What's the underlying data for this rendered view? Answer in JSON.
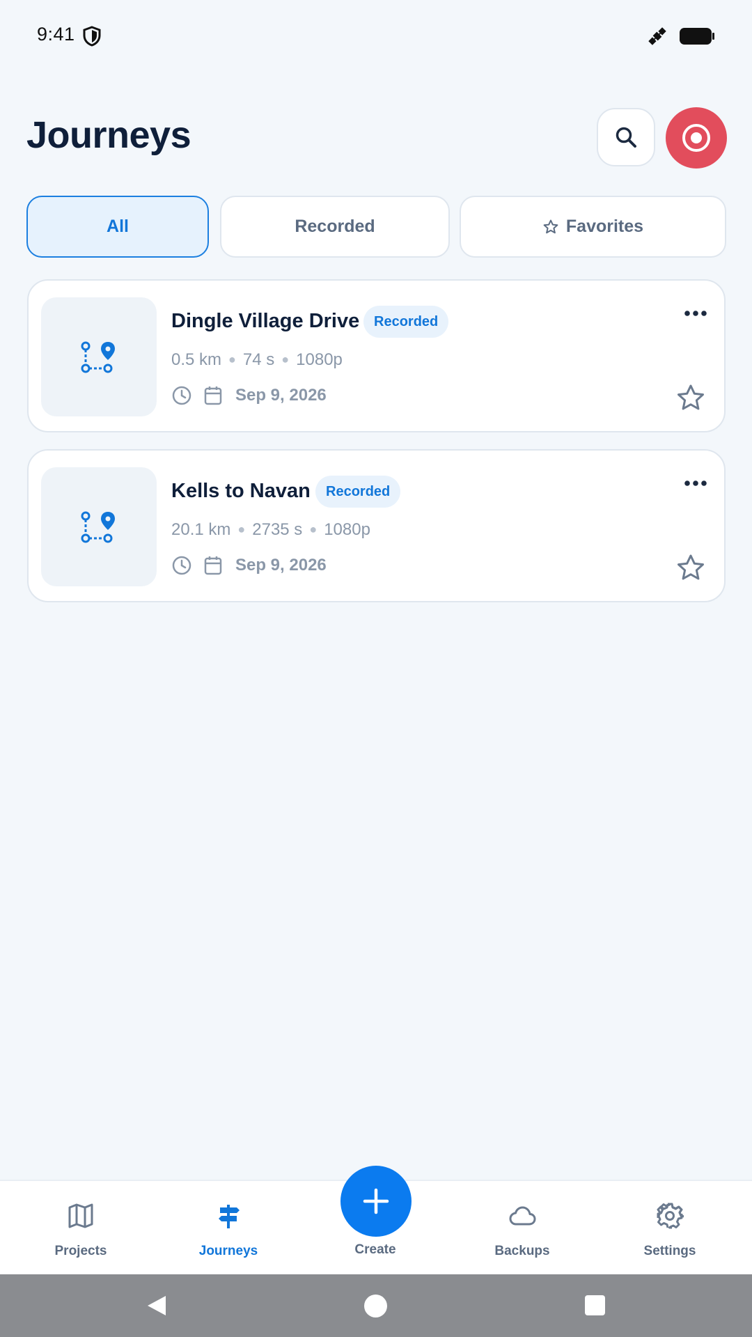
{
  "status_bar": {
    "time": "9:41"
  },
  "header": {
    "title": "Journeys",
    "search_icon": "search-icon",
    "record_icon": "record-icon"
  },
  "filters": {
    "all": "All",
    "recorded": "Recorded",
    "favorites": "Favorites",
    "active": "All"
  },
  "journeys": [
    {
      "title": "Dingle Village Drive",
      "badge": "Recorded",
      "distance": "0.5 km",
      "duration": "74 s",
      "resolution": "1080p",
      "date": "Sep 9, 2026",
      "favorite": false
    },
    {
      "title": "Kells to Navan",
      "badge": "Recorded",
      "distance": "20.1 km",
      "duration": "2735 s",
      "resolution": "1080p",
      "date": "Sep 9, 2026",
      "favorite": false
    }
  ],
  "bottom_nav": {
    "projects": "Projects",
    "journeys": "Journeys",
    "create": "Create",
    "backups": "Backups",
    "settings": "Settings",
    "active": "Journeys"
  },
  "colors": {
    "background": "#f3f7fb",
    "accent": "#1176d9",
    "record": "#e24d5c",
    "fab": "#0b7bef",
    "title": "#0f1f3a",
    "muted": "#8a97a8"
  }
}
